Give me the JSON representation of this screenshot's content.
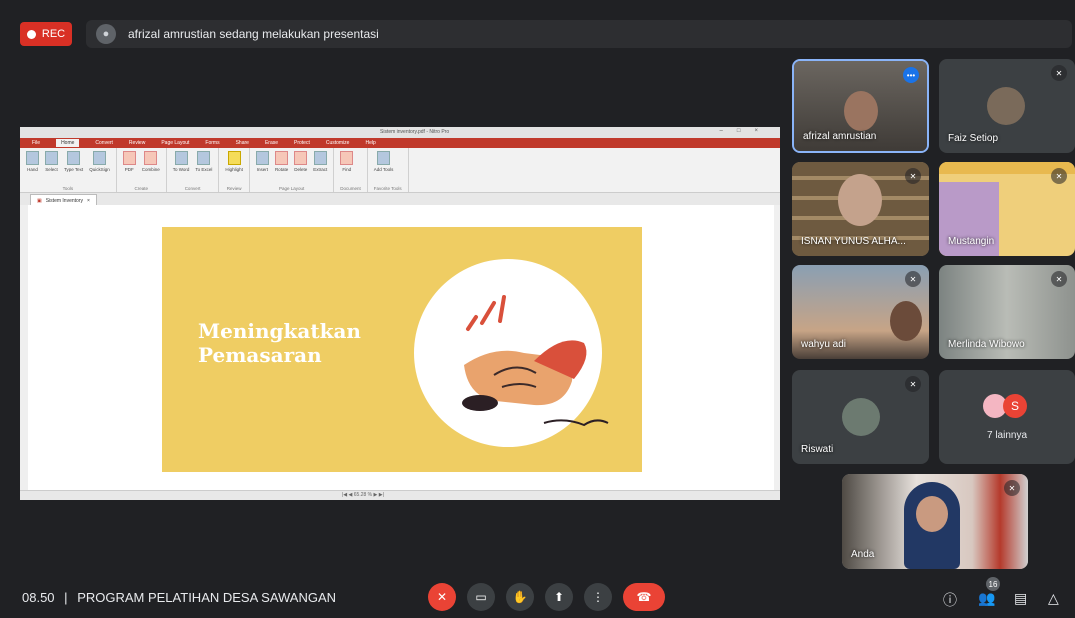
{
  "top": {
    "rec_label": "REC",
    "presenting_text": "afrizal amrustian sedang melakukan presentasi"
  },
  "screen_share": {
    "window_title": "Sistem inventory.pdf - Nitro Pro",
    "menu": [
      "File",
      "Home",
      "Convert",
      "Review",
      "Page Layout",
      "Forms",
      "Share",
      "Erase",
      "Protect",
      "Customize",
      "Help"
    ],
    "ribbon_groups": [
      {
        "name": "Tools",
        "items": [
          "Hand",
          "Edit",
          "Zoom",
          "Select",
          "Type Text",
          "QuickSign"
        ]
      },
      {
        "name": "Create",
        "items": [
          "PDF",
          "Combine"
        ]
      },
      {
        "name": "Convert",
        "items": [
          "To Word",
          "To Excel"
        ]
      },
      {
        "name": "Review",
        "items": [
          "Highlight"
        ]
      },
      {
        "name": "Page Layout",
        "items": [
          "Insert",
          "Rotate",
          "Delete",
          "Extract"
        ]
      },
      {
        "name": "Document",
        "items": [
          "Find"
        ]
      },
      {
        "name": "Favorite Tools",
        "items": [
          "Add Tools"
        ]
      }
    ],
    "doc_tab": "Sistem Inventory",
    "slide_title_line1": "Meningkatkan",
    "slide_title_line2": "Pemasaran",
    "zoom": "65.28 %"
  },
  "participants": [
    {
      "name": "afrizal amrustian",
      "muted": false,
      "active": true
    },
    {
      "name": "Faiz Setiop",
      "muted": true
    },
    {
      "name": "ISNAN YUNUS ALHA...",
      "muted": true
    },
    {
      "name": "Mustangin",
      "muted": true
    },
    {
      "name": "wahyu adi",
      "muted": true
    },
    {
      "name": "Merlinda Wibowo",
      "muted": true
    },
    {
      "name": "Riswati",
      "muted": true
    },
    {
      "name": "7 lainnya",
      "avatar_letter": "S"
    },
    {
      "name": "Anda",
      "muted": true
    }
  ],
  "bottom": {
    "time": "08.50",
    "separator": "|",
    "meeting_name": "PROGRAM PELATIHAN DESA SAWANGAN",
    "people_count": "16"
  },
  "colors": {
    "background": "#202124",
    "rec": "#d93025",
    "end_call": "#ea4335",
    "slide": "#efcd63",
    "active_border": "#8ab4f8"
  }
}
